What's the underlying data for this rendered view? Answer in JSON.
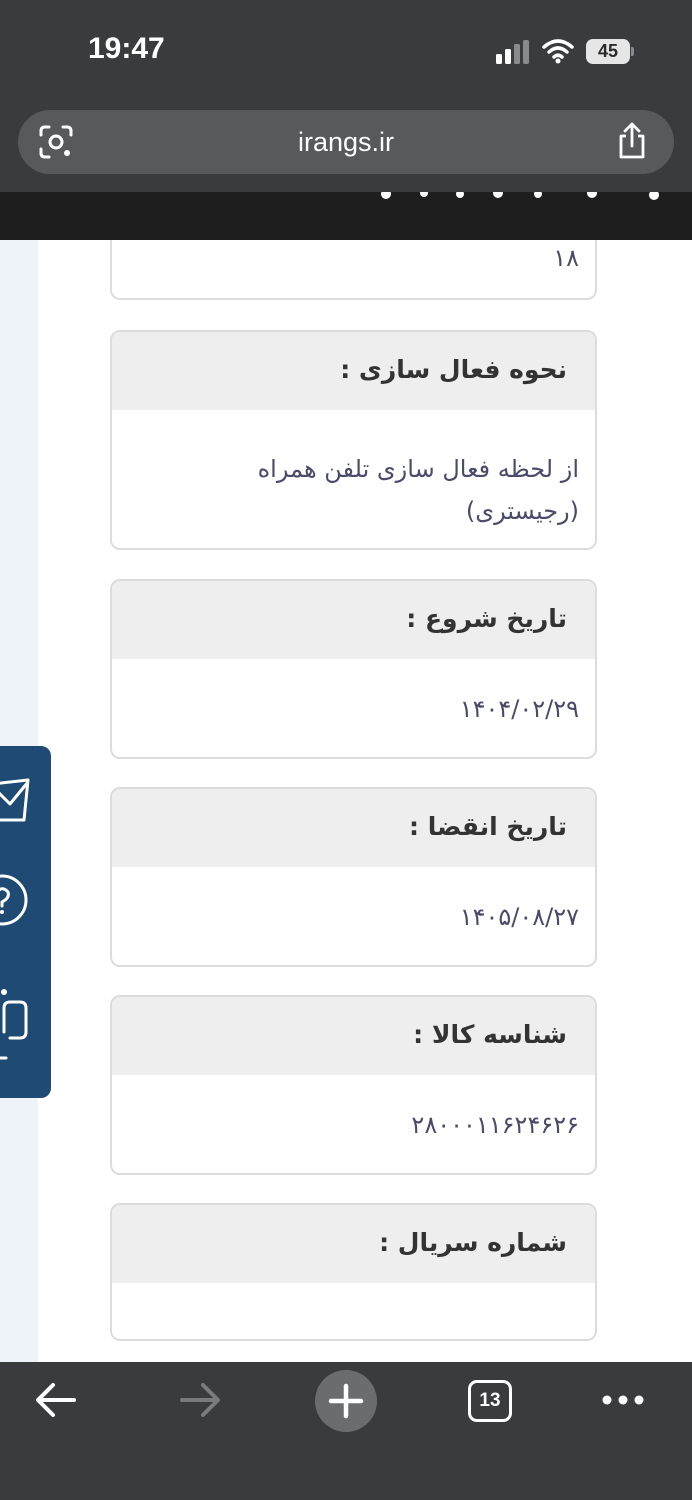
{
  "status_bar": {
    "time": "19:47",
    "battery": "45",
    "icons": [
      "signal-icon",
      "wifi-icon",
      "battery-icon"
    ]
  },
  "browser": {
    "url": "irangs.ir",
    "icons": [
      "lens-icon",
      "share-icon"
    ]
  },
  "content": {
    "partial_card_value": "۱۸",
    "cards": [
      {
        "label": "نحوه فعال سازی :",
        "value_lines": [
          "از لحظه فعال سازی تلفن همراه",
          "(رجیستری)"
        ]
      },
      {
        "label": "تاریخ شروع :",
        "value_lines": [
          "۱۴۰۴/۰۲/۲۹"
        ]
      },
      {
        "label": "تاریخ انقضا :",
        "value_lines": [
          "۱۴۰۵/۰۸/۲۷"
        ]
      },
      {
        "label": "شناسه کالا :",
        "value_lines": [
          "۲۸۰۰۰۱۱۶۲۴۶۲۶"
        ]
      },
      {
        "label": "شماره سریال :",
        "value_lines": []
      }
    ]
  },
  "float_widget": {
    "icons": [
      "mail-icon",
      "help-icon",
      "chat-icon"
    ]
  },
  "toolbar": {
    "tab_count": "13",
    "icons": [
      "back-icon",
      "forward-icon",
      "plus-icon",
      "tabs-icon",
      "more-icon"
    ]
  },
  "colors": {
    "chrome": "#3a3b3d",
    "url_bar": "#58595b",
    "card_header": "#eeeeee",
    "card_border": "#dcdcdc",
    "widget": "#1e4a73",
    "header_strip": "#1e1e1e"
  }
}
